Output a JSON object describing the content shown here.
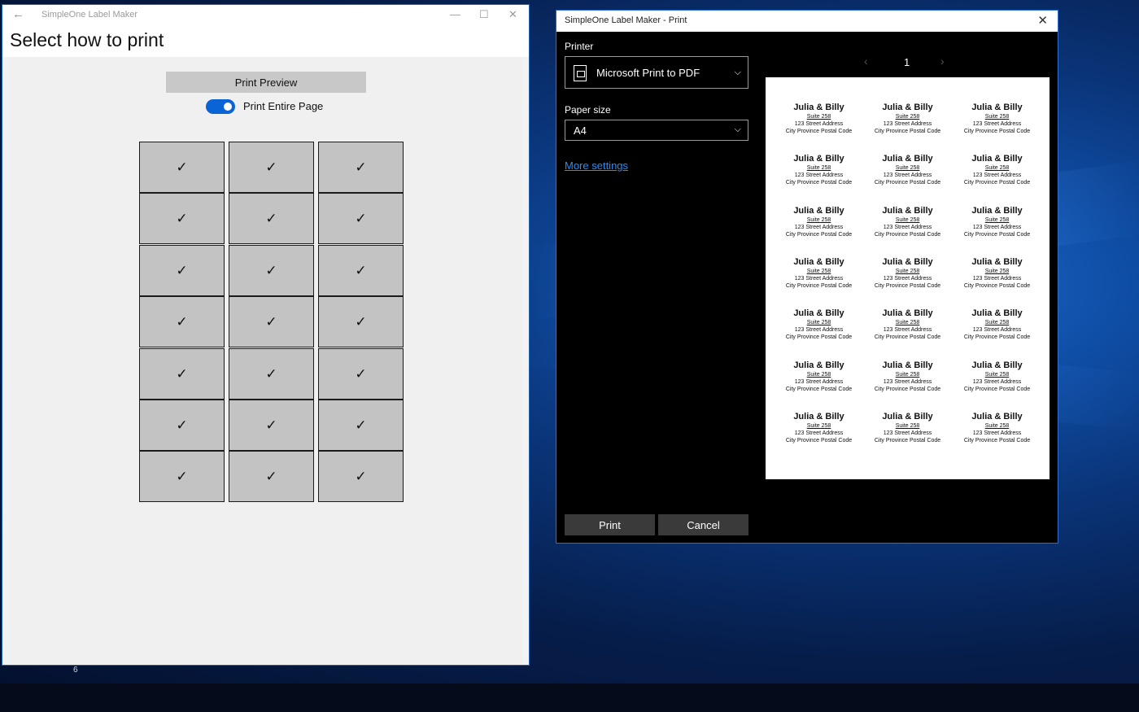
{
  "app_window": {
    "title": "SimpleOne Label Maker",
    "page_title": "Select how to print",
    "print_preview_label": "Print Preview",
    "print_entire_page_label": "Print Entire Page",
    "print_entire_page_on": true,
    "grid_check_glyph": "✓",
    "grid_rows": 7,
    "grid_cols": 3
  },
  "print_dialog": {
    "title": "SimpleOne Label Maker - Print",
    "printer_label": "Printer",
    "printer_value": "Microsoft Print to PDF",
    "paper_size_label": "Paper size",
    "paper_size_value": "A4",
    "more_settings": "More settings",
    "print_button": "Print",
    "cancel_button": "Cancel",
    "page_number": "1",
    "label_template": {
      "name": "Julia & Billy",
      "suite": "Suite 258",
      "street": "123 Street Address",
      "city": "City Province Postal Code"
    }
  },
  "taskbar": {
    "number": "6"
  },
  "colors": {
    "accent": "#0a64d6",
    "link": "#2b8cf2",
    "dialog_bg": "#000000",
    "cell_bg": "#c3c3c3"
  }
}
